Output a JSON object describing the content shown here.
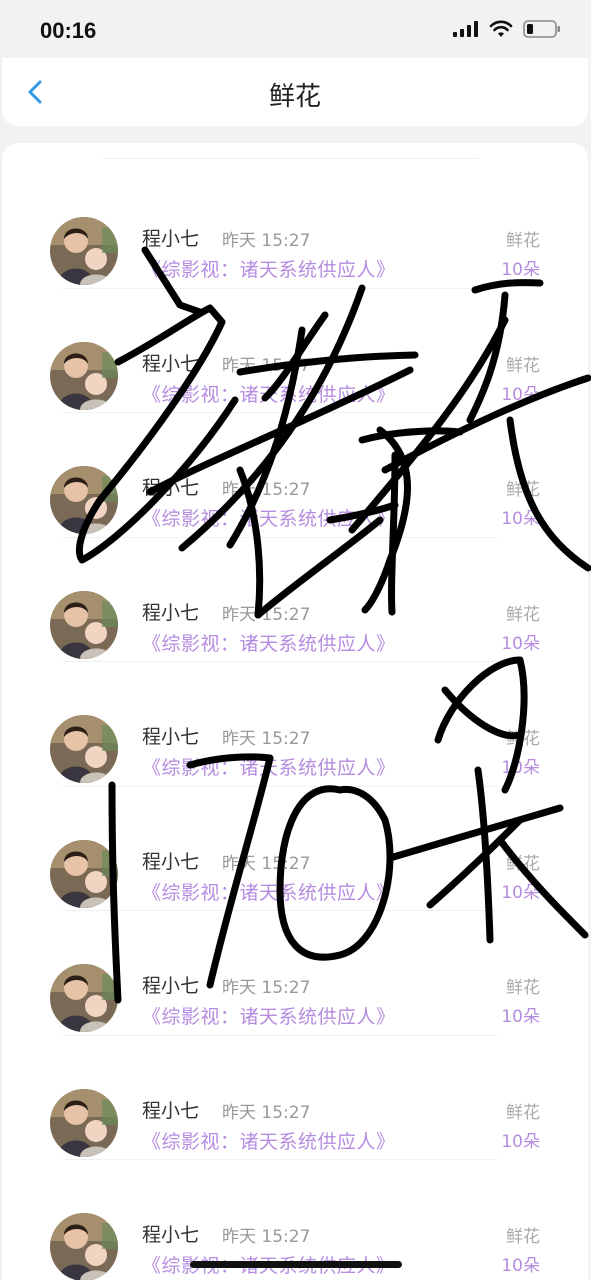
{
  "status": {
    "time": "00:16"
  },
  "nav": {
    "title": "鲜花"
  },
  "rows": [
    {
      "name": "程小七",
      "time": "昨天 15:27",
      "book": "《综影视：诸天系统供应人》",
      "type": "鲜花",
      "count": "10朵"
    },
    {
      "name": "程小七",
      "time": "昨天 15:27",
      "book": "《综影视：诸天系统供应人》",
      "type": "鲜花",
      "count": "10朵"
    },
    {
      "name": "程小七",
      "time": "昨天 15:27",
      "book": "《综影视：诸天系统供应人》",
      "type": "鲜花",
      "count": "10朵"
    },
    {
      "name": "程小七",
      "time": "昨天 15:27",
      "book": "《综影视：诸天系统供应人》",
      "type": "鲜花",
      "count": "10朵"
    },
    {
      "name": "程小七",
      "time": "昨天 15:27",
      "book": "《综影视：诸天系统供应人》",
      "type": "鲜花",
      "count": "10朵"
    },
    {
      "name": "程小七",
      "time": "昨天 15:27",
      "book": "《综影视：诸天系统供应人》",
      "type": "鲜花",
      "count": "10朵"
    },
    {
      "name": "程小七",
      "time": "昨天 15:27",
      "book": "《综影视：诸天系统供应人》",
      "type": "鲜花",
      "count": "10朵"
    },
    {
      "name": "程小七",
      "time": "昨天 15:27",
      "book": "《综影视：诸天系统供应人》",
      "type": "鲜花",
      "count": "10朵"
    },
    {
      "name": "程小七",
      "time": "昨天 15:27",
      "book": "《综影视：诸天系统供应人》",
      "type": "鲜花",
      "count": "10朵"
    }
  ],
  "annotation": {
    "text": "诸天 170朵"
  },
  "colors": {
    "accent": "#b58ce0",
    "back": "#2f9be6"
  }
}
